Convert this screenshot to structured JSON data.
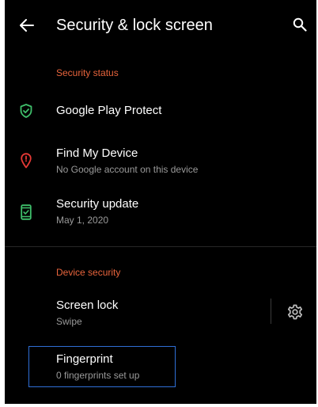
{
  "app_bar": {
    "title": "Security & lock screen",
    "back_icon": "arrow-left-icon",
    "search_icon": "search-icon"
  },
  "sections": {
    "security_status": {
      "header": "Security status",
      "items": [
        {
          "title": "Google Play Protect",
          "icon": "shield-check-icon"
        },
        {
          "title": "Find My Device",
          "subtitle": "No Google account on this device",
          "icon": "location-pin-icon"
        },
        {
          "title": "Security update",
          "subtitle": "May 1, 2020",
          "icon": "phone-check-icon"
        }
      ]
    },
    "device_security": {
      "header": "Device security",
      "items": [
        {
          "title": "Screen lock",
          "subtitle": "Swipe",
          "settings_icon": "gear-icon"
        },
        {
          "title": "Fingerprint",
          "subtitle": "0 fingerprints set up"
        }
      ]
    }
  },
  "colors": {
    "background": "#000000",
    "accent": "#e8643c",
    "shield": "#3fbf6b",
    "pin": "#e53935",
    "phone": "#3fbf6b",
    "focus": "#2f6fd6"
  }
}
